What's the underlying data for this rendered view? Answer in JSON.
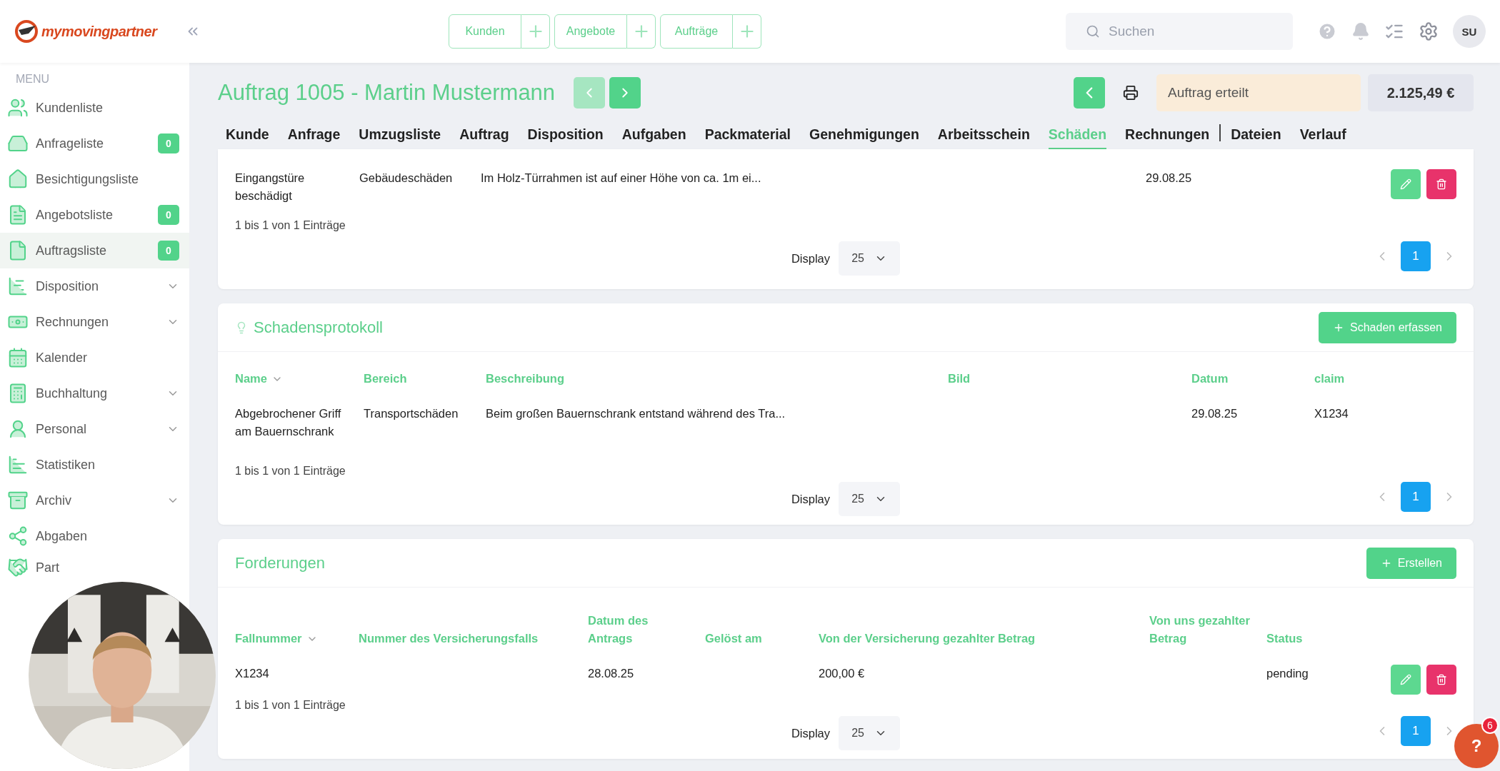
{
  "topbar": {
    "logo": "mymovingpartner",
    "quick_actions": [
      {
        "label": "Kunden"
      },
      {
        "label": "Angebote"
      },
      {
        "label": "Aufträge"
      }
    ],
    "search": {
      "placeholder": "Suchen"
    },
    "avatar": "SU"
  },
  "sidebar": {
    "menu_label": "MENU",
    "items": [
      {
        "label": "Kundenliste",
        "expandable": false,
        "selected": false
      },
      {
        "label": "Anfrageliste",
        "badge": "0",
        "expandable": false,
        "selected": false
      },
      {
        "label": "Besichtigungsliste",
        "expandable": false,
        "selected": false
      },
      {
        "label": "Angebotsliste",
        "badge": "0",
        "expandable": false,
        "selected": false
      },
      {
        "label": "Auftragsliste",
        "badge": "0",
        "expandable": false,
        "selected": true
      },
      {
        "label": "Disposition",
        "expandable": true,
        "selected": false
      },
      {
        "label": "Rechnungen",
        "expandable": true,
        "selected": false
      },
      {
        "label": "Kalender",
        "expandable": false,
        "selected": false
      },
      {
        "label": "Buchhaltung",
        "expandable": true,
        "selected": false
      },
      {
        "label": "Personal",
        "expandable": true,
        "selected": false
      },
      {
        "label": "Statistiken",
        "expandable": false,
        "selected": false
      },
      {
        "label": "Archiv",
        "expandable": true,
        "selected": false
      },
      {
        "label": "Abgaben",
        "expandable": false,
        "selected": false
      },
      {
        "label": "Part",
        "expandable": false,
        "selected": false
      }
    ]
  },
  "header": {
    "title": "Auftrag 1005 - Martin Mustermann",
    "prev_disabled": true,
    "next_disabled": false,
    "status": "Auftrag erteilt",
    "amount": "2.125,49 €"
  },
  "tabs": [
    {
      "label": "Kunde",
      "selected": false
    },
    {
      "label": "Anfrage",
      "selected": false
    },
    {
      "label": "Umzugsliste",
      "selected": false
    },
    {
      "label": "Auftrag",
      "selected": false
    },
    {
      "label": "Disposition",
      "selected": false
    },
    {
      "label": "Aufgaben",
      "selected": false
    },
    {
      "label": "Packmaterial",
      "selected": false
    },
    {
      "label": "Genehmigungen",
      "selected": false
    },
    {
      "label": "Arbeitsschein",
      "selected": false
    },
    {
      "label": "Schäden",
      "selected": true
    },
    {
      "label": "Rechnungen",
      "selected": false
    },
    {
      "label": "Dateien",
      "selected": false
    },
    {
      "label": "Verlauf",
      "selected": false
    }
  ],
  "sections": [
    {
      "actions": true,
      "rows": [
        {
          "cells": [
            {
              "kind": "text",
              "text": "Eingangstüre beschädigt"
            },
            {
              "kind": "text",
              "text": "Gebäudeschäden"
            },
            {
              "kind": "text",
              "text": "Im Holz-Türrahmen ist auf einer Höhe von ca. 1m ei..."
            },
            {
              "kind": "text",
              "text": "29.08.25"
            }
          ]
        }
      ],
      "footer": {
        "summary": "1 bis 1 von 1 Einträge",
        "display_label": "Display",
        "page_size": "25",
        "pages": [
          {
            "label": "1",
            "selected": true
          }
        ]
      }
    },
    {
      "title": "Schadensprotokoll",
      "button": "Schaden erfassen",
      "columns": [
        {
          "label": "Name",
          "sorted": true
        },
        {
          "label": "Bereich",
          "sorted": false
        },
        {
          "label": "Beschreibung",
          "sorted": false
        },
        {
          "label": "Bild",
          "sorted": false
        },
        {
          "label": "Datum",
          "sorted": false
        },
        {
          "label": "claim",
          "sorted": false
        }
      ],
      "actions": false,
      "rows": [
        {
          "cells": [
            {
              "kind": "text",
              "text": "Abgebrochener Griff am Bauernschrank"
            },
            {
              "kind": "text",
              "text": "Transportschäden"
            },
            {
              "kind": "text",
              "text": "Beim großen Bauernschrank entstand während des Tra..."
            },
            {
              "kind": "blank"
            },
            {
              "kind": "text",
              "text": "29.08.25"
            },
            {
              "kind": "text",
              "text": "X1234"
            }
          ]
        }
      ],
      "footer": {
        "summary": "1 bis 1 von 1 Einträge",
        "display_label": "Display",
        "page_size": "25",
        "pages": [
          {
            "label": "1",
            "selected": true
          }
        ]
      }
    },
    {
      "title": "Forderungen",
      "button": "Erstellen",
      "columns": [
        {
          "label": "Fallnummer",
          "sorted": true
        },
        {
          "label": "Nummer des Versicherungsfalls",
          "sorted": false
        },
        {
          "label": "Datum des Antrags",
          "sorted": false
        },
        {
          "label": "Gelöst am",
          "sorted": false
        },
        {
          "label": "Von der Versicherung gezahlter Betrag",
          "sorted": false
        },
        {
          "label": "Von uns gezahlter Betrag",
          "sorted": false
        },
        {
          "label": "Status",
          "sorted": false
        }
      ],
      "actions": true,
      "rows": [
        {
          "cells": [
            {
              "kind": "text",
              "text": "X1234"
            },
            {
              "kind": "blank"
            },
            {
              "kind": "text",
              "text": "28.08.25"
            },
            {
              "kind": "blank"
            },
            {
              "kind": "text",
              "text": "200,00 €"
            },
            {
              "kind": "blank"
            },
            {
              "kind": "text",
              "text": "pending"
            }
          ]
        }
      ],
      "footer": {
        "summary": "1 bis 1 von 1 Einträge",
        "display_label": "Display",
        "page_size": "25",
        "pages": [
          {
            "label": "1",
            "selected": true
          }
        ]
      }
    }
  ],
  "help_button": {
    "label": "?",
    "badge": "6"
  }
}
